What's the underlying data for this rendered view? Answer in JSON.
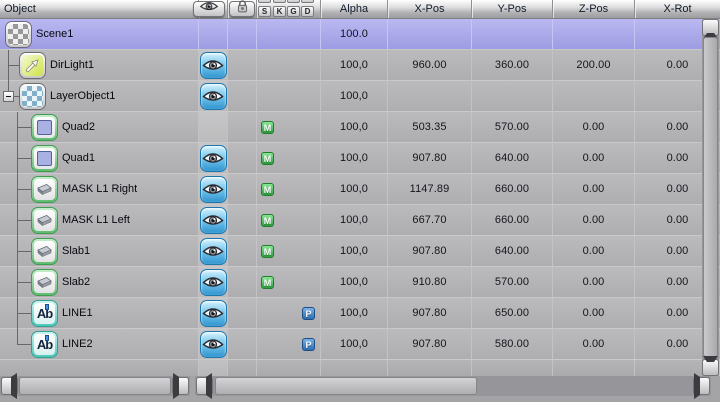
{
  "header": {
    "object_label": "Object",
    "numeric_columns": [
      "Alpha",
      "X-Pos",
      "Y-Pos",
      "Z-Pos",
      "X-Rot"
    ],
    "skgd_buttons": [
      "S",
      "K",
      "G",
      "D"
    ],
    "icon_buttons": [
      "eye-icon",
      "lock-icon"
    ]
  },
  "rows": [
    {
      "name": "Scene1",
      "icon": "scene-checker",
      "level": 0,
      "selected": true,
      "eye": false,
      "badge": "",
      "expander": "",
      "last": false,
      "values": {
        "alpha": "100.0",
        "x": "",
        "y": "",
        "z": "",
        "xrot": ""
      }
    },
    {
      "name": "DirLight1",
      "icon": "dirlight-arrow",
      "level": 1,
      "selected": false,
      "eye": true,
      "badge": "",
      "expander": "",
      "last": false,
      "values": {
        "alpha": "100,0",
        "x": "960.00",
        "y": "360.00",
        "z": "200.00",
        "xrot": "0.00"
      }
    },
    {
      "name": "LayerObject1",
      "icon": "layer-checker",
      "level": 1,
      "selected": false,
      "eye": true,
      "badge": "",
      "expander": "minus",
      "last": true,
      "values": {
        "alpha": "100,0",
        "x": "",
        "y": "",
        "z": "",
        "xrot": ""
      }
    },
    {
      "name": "Quad2",
      "icon": "quad",
      "level": 2,
      "selected": false,
      "eye": false,
      "badge": "M",
      "expander": "",
      "last": false,
      "values": {
        "alpha": "100,0",
        "x": "503.35",
        "y": "570.00",
        "z": "0.00",
        "xrot": "0.00"
      }
    },
    {
      "name": "Quad1",
      "icon": "quad",
      "level": 2,
      "selected": false,
      "eye": true,
      "badge": "M",
      "expander": "",
      "last": false,
      "values": {
        "alpha": "100,0",
        "x": "907.80",
        "y": "640.00",
        "z": "0.00",
        "xrot": "0.00"
      }
    },
    {
      "name": "MASK L1 Right",
      "icon": "slab",
      "level": 2,
      "selected": false,
      "eye": true,
      "badge": "M",
      "expander": "",
      "last": false,
      "values": {
        "alpha": "100,0",
        "x": "1147.89",
        "y": "660.00",
        "z": "0.00",
        "xrot": "0.00"
      }
    },
    {
      "name": "MASK L1 Left",
      "icon": "slab",
      "level": 2,
      "selected": false,
      "eye": true,
      "badge": "M",
      "expander": "",
      "last": false,
      "values": {
        "alpha": "100,0",
        "x": "667.70",
        "y": "660.00",
        "z": "0.00",
        "xrot": "0.00"
      }
    },
    {
      "name": "Slab1",
      "icon": "slab",
      "level": 2,
      "selected": false,
      "eye": true,
      "badge": "M",
      "expander": "",
      "last": false,
      "values": {
        "alpha": "100,0",
        "x": "907.80",
        "y": "640.00",
        "z": "0.00",
        "xrot": "0.00"
      }
    },
    {
      "name": "Slab2",
      "icon": "slab",
      "level": 2,
      "selected": false,
      "eye": true,
      "badge": "M",
      "expander": "",
      "last": false,
      "values": {
        "alpha": "100,0",
        "x": "910.80",
        "y": "570.00",
        "z": "0.00",
        "xrot": "0.00"
      }
    },
    {
      "name": "LINE1",
      "icon": "text-ab",
      "level": 2,
      "selected": false,
      "eye": true,
      "badge": "P",
      "expander": "",
      "last": false,
      "values": {
        "alpha": "100,0",
        "x": "907.80",
        "y": "650.00",
        "z": "0.00",
        "xrot": "0.00"
      }
    },
    {
      "name": "LINE2",
      "icon": "text-ab",
      "level": 2,
      "selected": false,
      "eye": true,
      "badge": "P",
      "expander": "",
      "last": true,
      "values": {
        "alpha": "100,0",
        "x": "907.80",
        "y": "580.00",
        "z": "0.00",
        "xrot": "0.00"
      }
    }
  ],
  "colors": {
    "selection_purple": "#a5a3e6",
    "row_gray": "#b1b1b3",
    "eye_icon_blue": "#2f95cf",
    "badge_m_green": "#2fa140",
    "badge_p_blue": "#2d6fb2",
    "quad_icon_fill": "#a9b1e2",
    "ring_green": "#5fbb70",
    "ring_teal": "#4cc8ba",
    "dirlight_yellow": "#cfe24a"
  }
}
